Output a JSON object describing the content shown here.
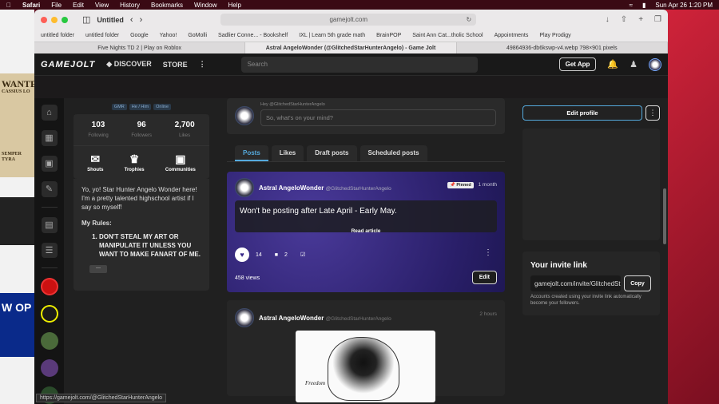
{
  "menubar": {
    "app": "Safari",
    "items": [
      "File",
      "Edit",
      "View",
      "History",
      "Bookmarks",
      "Window",
      "Help"
    ],
    "datetime": "Sun Apr 26  1:20 PM"
  },
  "desktop": {
    "poster_text": "WANTE",
    "poster_sub": "CASSIUS LO",
    "poster_foot": "SEMPER TYRA",
    "wop": "W OP"
  },
  "browser": {
    "tab_group": "Untitled",
    "url": "gamejolt.com",
    "bookmarks": [
      "untitled folder",
      "untitled folder",
      "Google",
      "Yahoo!",
      "GoMolli",
      "Sadlier Conne... - Bookshelf",
      "IXL | Learn 5th grade math",
      "BrainPOP",
      "Saint Ann Cat...tholic School",
      "Appointments",
      "Play Prodigy"
    ],
    "tabs": [
      "Five Nights TD 2 | Play on Roblox",
      "Astral AngeloWonder (@GlitchedStarHunterAngelo) - Game Jolt",
      "49864936-db6kswp-v4.webp 798×901 pixels"
    ]
  },
  "gj": {
    "logo": "GAMEJOLT",
    "nav": [
      "DISCOVER",
      "STORE"
    ],
    "search_placeholder": "Search",
    "get_app": "Get App"
  },
  "profile": {
    "badges": [
      "GMR",
      "He / Him",
      "Online"
    ],
    "stats": [
      {
        "value": "103",
        "label": "Following"
      },
      {
        "value": "96",
        "label": "Followers"
      },
      {
        "value": "2,700",
        "label": "Likes"
      }
    ],
    "links": [
      "Shouts",
      "Trophies",
      "Communities"
    ],
    "bio": "Yo, yo! Star Hunter Angelo Wonder here! I'm a pretty talented highschool artist if I say so myself!",
    "rules_title": "My Rules:",
    "rule1": "DON'T STEAL MY ART OR MANIPULATE IT UNLESS YOU WANT TO MAKE FANART OF ME.",
    "more": "—"
  },
  "composer": {
    "hey": "Hey @GlitchedStarHunterAngelo",
    "placeholder": "So, what's on your mind?"
  },
  "feed_tabs": [
    "Posts",
    "Likes",
    "Draft posts",
    "Scheduled posts"
  ],
  "post1": {
    "name": "Astral AngeloWonder",
    "handle": "@GlitchedStarHunterAngelo",
    "pinned": "Pinned",
    "time": "1 month",
    "text": "Won't be posting after Late April - Early May.",
    "read": "Read article",
    "likes": "14",
    "comments": "2",
    "views": "458 views",
    "edit": "Edit"
  },
  "post2": {
    "name": "Astral AngeloWonder",
    "handle": "@GlitchedStarHunterAngelo",
    "time": "2 hours",
    "sketch_text": "Freedom"
  },
  "right": {
    "edit_profile": "Edit profile",
    "invite_title": "Your invite link",
    "invite_url": "gamejolt.com/invite/GlitchedStarHunterAngelo",
    "copy": "Copy",
    "invite_desc": "Accounts created using your invite link automatically become your followers."
  },
  "status_url": "https://gamejolt.com/@GlitchedStarHunterAngelo"
}
